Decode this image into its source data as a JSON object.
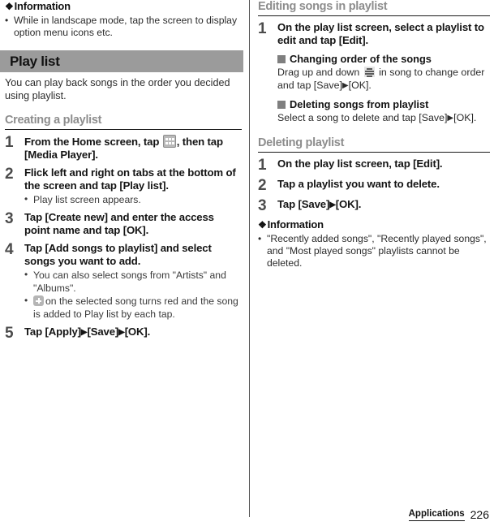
{
  "left_column": {
    "information": {
      "glyph": "❖",
      "heading": "Information",
      "bullets": [
        "While in landscape mode, tap the screen to display option menu icons etc."
      ]
    },
    "title_bar": {
      "label": "Play list"
    },
    "intro": "You can play back songs in the order you decided using playlist.",
    "section": {
      "heading": "Creating a playlist",
      "steps": [
        {
          "num": "1",
          "title_pre": "From the Home screen, tap ",
          "icon": "app-drawer-icon",
          "title_post": ", then tap [Media Player].",
          "bullets": []
        },
        {
          "num": "2",
          "title_pre": "Flick left and right on tabs at the bottom of the screen and tap [Play list].",
          "icon": "",
          "title_post": "",
          "bullets": [
            "Play list screen appears."
          ]
        },
        {
          "num": "3",
          "title_pre": "Tap [Create new] and enter the access point name and tap [OK].",
          "icon": "",
          "title_post": "",
          "bullets": []
        },
        {
          "num": "4",
          "title_pre": "Tap [Add songs to playlist] and select songs you want to add.",
          "icon": "",
          "title_post": "",
          "bullets": [
            "You can also select songs from \"Artists\" and \"Albums\".",
            "on the selected song turns red and the song is added to Play list by each tap."
          ],
          "bullet_icon": "plus-icon",
          "bullet_icon_index": 1
        },
        {
          "num": "5",
          "title_pre": "Tap [Apply]",
          "arrow1": "▶",
          "title_mid": "[Save]",
          "arrow2": "▶",
          "title_post2": "[OK].",
          "icon": "",
          "title_post": "",
          "bullets": []
        }
      ]
    }
  },
  "right_column": {
    "section_editing": {
      "heading": "Editing songs in playlist",
      "step": {
        "num": "1",
        "title": "On the play list screen, select a playlist to edit and tap [Edit]."
      },
      "subsections": [
        {
          "heading": "Changing order of the songs",
          "body_pre": "Drag up and down ",
          "icon": "drag-handle-icon",
          "body_mid": " in song to change order and tap [Save]",
          "arrow": "▶",
          "body_post": "[OK]."
        },
        {
          "heading": "Deleting songs from playlist",
          "body_pre": "Select a song to delete and tap [Save]",
          "icon": "",
          "body_mid": "",
          "arrow": "▶",
          "body_post": "[OK]."
        }
      ]
    },
    "section_deleting": {
      "heading": "Deleting playlist",
      "steps": [
        {
          "num": "1",
          "title": "On the play list screen, tap [Edit]."
        },
        {
          "num": "2",
          "title": "Tap a playlist you want to delete."
        },
        {
          "num": "3",
          "title_pre": "Tap [Save]",
          "arrow": "▶",
          "title_post": "[OK]."
        }
      ]
    },
    "information": {
      "glyph": "❖",
      "heading": "Information",
      "bullets": [
        "\"Recently added songs\", \"Recently played songs\", and \"Most played songs\" playlists cannot be deleted."
      ]
    }
  },
  "footer": {
    "section_label": "Applications",
    "page_number": "226"
  }
}
